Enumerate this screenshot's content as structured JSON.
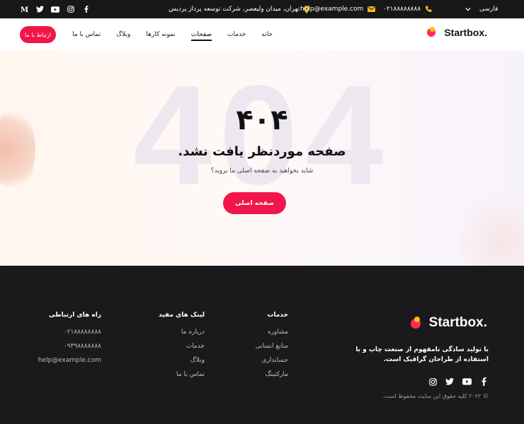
{
  "topbar": {
    "language": "فارسی",
    "phone": "۰۲۱۸۸۸۸۸۸۸۸",
    "email": "help@example.com",
    "address": "تهران، میدان ولیعصر، شرکت توسعه پرداز پردیس"
  },
  "header": {
    "logo": "Startbox.",
    "nav": [
      "خانه",
      "خدمات",
      "صفحات",
      "نمونه کارها",
      "وبلاگ",
      "تماس با ما"
    ],
    "active_nav": "صفحات",
    "contact_button": "ارتباط با ما"
  },
  "hero": {
    "bg_number": "404",
    "error_code": "۴۰۴",
    "title": "صفحه موردنظر یافت نشد.",
    "subtitle": "شاید بخواهید به صفحه اصلی ما بروید؟",
    "home_button": "صفحه اصلی"
  },
  "footer": {
    "logo": "Startbox.",
    "description": "با تولید سادگی نامفهوم از صنعت چاپ و با استفاده از طراحان گرافیک است.",
    "copyright": "© ۲۰۲۲ کلیه حقوق این سایت محفوظ است.",
    "services": {
      "title": "خدمات",
      "items": [
        "مشاوره",
        "منابع انسانی",
        "حسابداری",
        "مارکتینگ"
      ]
    },
    "links": {
      "title": "لینک های مفید",
      "items": [
        "درباره ما",
        "خدمات",
        "وبلاگ",
        "تماس با ما"
      ]
    },
    "contact": {
      "title": "راه های ارتباطی",
      "items": [
        "۰۲۱۸۸۸۸۸۸۸۸",
        "۰۹۳۹۸۸۸۸۸۸۸",
        "help@example.com"
      ]
    }
  },
  "colors": {
    "accent": "#f0164a",
    "dark": "#1a1a1d",
    "yellow": "#ffc107"
  }
}
